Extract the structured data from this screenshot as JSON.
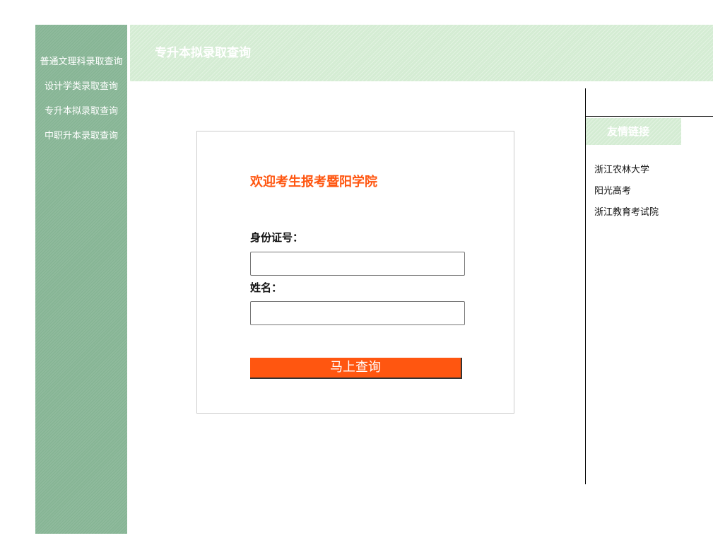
{
  "sidebar": {
    "items": [
      {
        "label": "普通文理科录取查询"
      },
      {
        "label": "设计学类录取查询"
      },
      {
        "label": "专升本拟录取查询"
      },
      {
        "label": "中职升本录取查询"
      }
    ]
  },
  "header": {
    "title": "专升本拟录取查询"
  },
  "form": {
    "welcome": "欢迎考生报考暨阳学院",
    "id_label": "身份证号：",
    "id_value": "",
    "name_label": "姓名：",
    "name_value": "",
    "submit_label": "马上查询"
  },
  "links": {
    "title": "友情链接",
    "items": [
      {
        "label": "浙江农林大学"
      },
      {
        "label": "阳光高考"
      },
      {
        "label": "浙江教育考试院"
      }
    ]
  },
  "colors": {
    "sidebar_bg": "#87b595",
    "header_bg": "#d4ecd3",
    "accent": "#ff5610"
  }
}
